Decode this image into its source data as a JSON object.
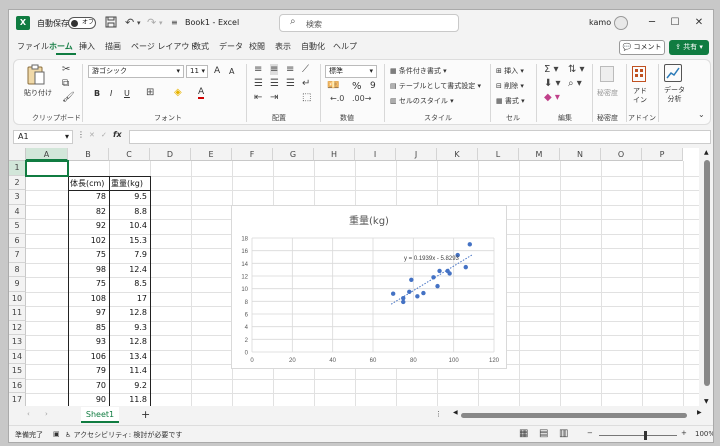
{
  "titlebar": {
    "app_icon": "X",
    "autosave_label": "自動保存",
    "autosave_state": "オフ",
    "save_icon": "save-icon",
    "undo_icon": "undo-icon",
    "redo_icon": "redo-icon",
    "customize_icon": "customize-qat-icon",
    "document_title": "Book1 - Excel",
    "search_placeholder": "検索",
    "user_name": "kamo",
    "minimize": "─",
    "maximize": "☐",
    "close": "✕"
  },
  "menu": {
    "items": [
      "ファイル",
      "ホーム",
      "挿入",
      "描画",
      "ページ レイアウト",
      "数式",
      "データ",
      "校閲",
      "表示",
      "自動化",
      "ヘルプ"
    ],
    "active": "ホーム",
    "comment_button": "コメント",
    "share_button": "共有"
  },
  "ribbon": {
    "clipboard": {
      "paste_label": "貼り付け",
      "group_label": "クリップボード"
    },
    "font": {
      "font_name": "游ゴシック",
      "font_size": "11",
      "grow": "A",
      "shrink": "A",
      "bold": "B",
      "italic": "I",
      "underline": "U",
      "group_label": "フォント"
    },
    "alignment": {
      "group_label": "配置"
    },
    "number": {
      "format": "標準",
      "percent": "%",
      "comma": "9",
      "group_label": "数値"
    },
    "styles": {
      "conditional": "条件付き書式",
      "table": "テーブルとして書式設定",
      "cell_styles": "セルのスタイル",
      "group_label": "スタイル"
    },
    "cells": {
      "insert": "挿入",
      "delete": "削除",
      "format": "書式",
      "group_label": "セル"
    },
    "editing": {
      "group_label": "編集"
    },
    "sensitivity": {
      "label": "秘密度",
      "group_label": "秘密度"
    },
    "addins": {
      "label": "アド\nイン",
      "group_label": "アドイン"
    },
    "analysis": {
      "label": "データ\n分析"
    }
  },
  "formula_bar": {
    "name_box": "A1",
    "fx": "fx",
    "cancel": "✕",
    "enter": "✓",
    "value": ""
  },
  "grid": {
    "columns": [
      "A",
      "B",
      "C",
      "D",
      "E",
      "F",
      "G",
      "H",
      "I",
      "J",
      "K",
      "L",
      "M",
      "N",
      "O",
      "P"
    ],
    "rows": [
      "1",
      "2",
      "3",
      "4",
      "5",
      "6",
      "7",
      "8",
      "9",
      "10",
      "11",
      "12",
      "13",
      "14",
      "15",
      "16",
      "17"
    ],
    "header_b": "体長(cm)",
    "header_c": "重量(kg)",
    "length": [
      78,
      82,
      92,
      102,
      75,
      98,
      75,
      108,
      97,
      85,
      93,
      106,
      79,
      70,
      90
    ],
    "weight": [
      9.5,
      8.8,
      10.4,
      15.3,
      7.9,
      12.4,
      8.5,
      17,
      12.8,
      9.3,
      12.8,
      13.4,
      11.4,
      9.2,
      11.8
    ]
  },
  "chart_data": {
    "type": "scatter",
    "title": "重量(kg)",
    "x": [
      78,
      82,
      92,
      102,
      75,
      98,
      75,
      108,
      97,
      85,
      93,
      106,
      79,
      70,
      90
    ],
    "y": [
      9.5,
      8.8,
      10.4,
      15.3,
      7.9,
      12.4,
      8.5,
      17,
      12.8,
      9.3,
      12.8,
      13.4,
      11.4,
      9.2,
      11.8
    ],
    "xlim": [
      0,
      120
    ],
    "ylim": [
      0,
      18
    ],
    "xticks": [
      0,
      20,
      40,
      60,
      80,
      100,
      120
    ],
    "yticks": [
      0,
      2,
      4,
      6,
      8,
      10,
      12,
      14,
      16,
      18
    ],
    "trendline": {
      "type": "linear",
      "slope": 0.1939,
      "intercept": -5.8293,
      "label": "y = 0.1939x - 5.8293"
    },
    "grid": true,
    "point_color": "#4472c4"
  },
  "sheets": {
    "tabs": [
      "Sheet1"
    ],
    "active": "Sheet1",
    "add": "+"
  },
  "status": {
    "ready": "準備完了",
    "accessibility": "アクセシビリティ: 検討が必要です",
    "zoom": "100%",
    "zoom_out": "−",
    "zoom_in": "+"
  }
}
